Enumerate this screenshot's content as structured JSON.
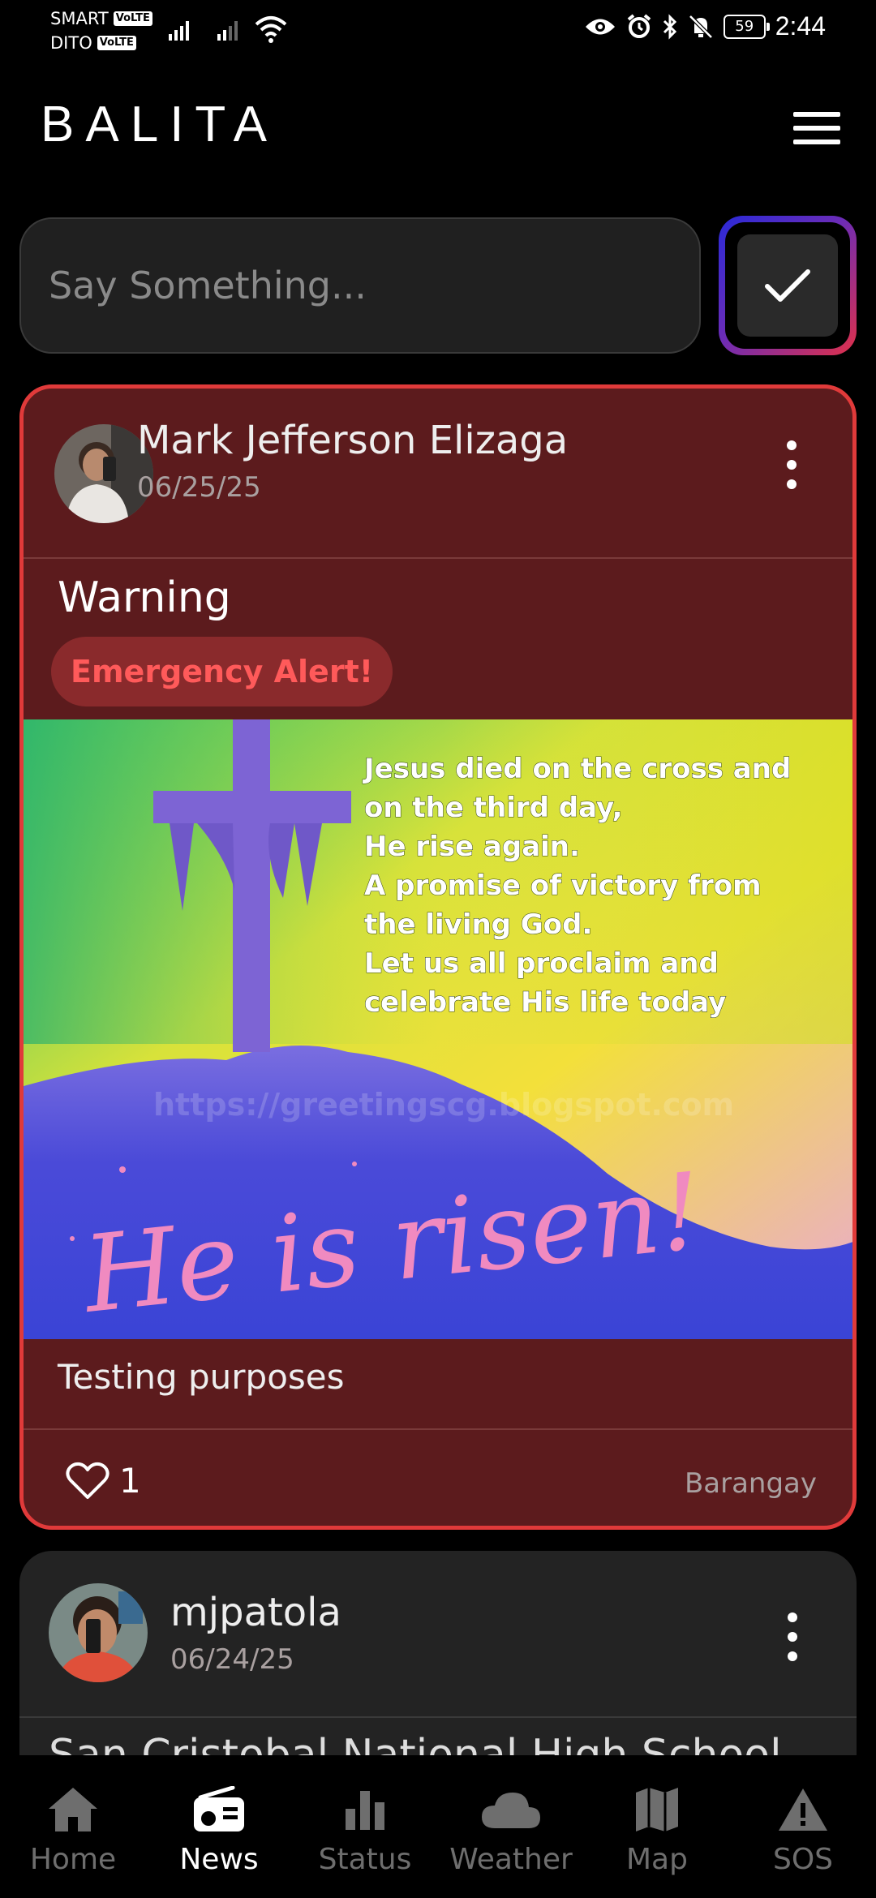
{
  "status_bar": {
    "carrier1": "SMART",
    "carrier2": "DITO",
    "volte": "VoLTE",
    "battery": "59",
    "time": "2:44"
  },
  "header": {
    "brand": "BALITA",
    "menu_icon": "hamburger-menu-icon"
  },
  "composer": {
    "placeholder": "Say Something...",
    "submit_icon": "checkmark-icon"
  },
  "posts": [
    {
      "author": "Mark Jefferson Elizaga",
      "date": "06/25/25",
      "title": "Warning",
      "tag": "Emergency Alert!",
      "image_text": [
        "Jesus died on the cross and",
        "on the third day,",
        "He rise again.",
        "A promise of victory from",
        "the living God.",
        "Let us all proclaim and",
        "celebrate His life today"
      ],
      "image_watermark": "https://greetingscg.blogspot.com",
      "image_script": "He is risen!",
      "body": "Testing purposes",
      "likes": "1",
      "scope": "Barangay",
      "accent": "#e03a3a"
    },
    {
      "author": "mjpatola",
      "date": "06/24/25",
      "title": "San Cristobal National High School"
    }
  ],
  "nav": [
    {
      "label": "Home",
      "icon": "home-icon"
    },
    {
      "label": "News",
      "icon": "radio-icon"
    },
    {
      "label": "Status",
      "icon": "bar-chart-icon"
    },
    {
      "label": "Weather",
      "icon": "cloud-icon"
    },
    {
      "label": "Map",
      "icon": "map-icon"
    },
    {
      "label": "SOS",
      "icon": "warning-icon"
    }
  ]
}
